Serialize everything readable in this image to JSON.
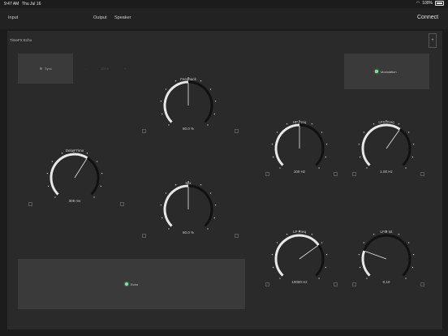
{
  "status": {
    "time": "9:47 AM",
    "date": "Thu Jul 16",
    "battery": "100%"
  },
  "nav": {
    "input": "Input",
    "output": "Output",
    "speaker": "Speaker",
    "connect": "Connect"
  },
  "panel": {
    "title": "TimeFX Echo",
    "add_label": "+"
  },
  "sync": {
    "label": "Sync",
    "minus": "-",
    "value": "120.0",
    "plus": "+"
  },
  "modulation": {
    "label": "Modulation"
  },
  "echo": {
    "label": "Echo"
  },
  "knobs": [
    {
      "name": "feedback",
      "label": "Feedback",
      "value": "50.0 %",
      "level": 0.5
    },
    {
      "name": "delay-time",
      "label": "Delay Time",
      "value": "309 ms",
      "level": 0.62
    },
    {
      "name": "mix",
      "label": "Mix",
      "value": "50.0 %",
      "level": 0.5
    },
    {
      "name": "hp-freq",
      "label": "HP Freq",
      "value": "100 Hz",
      "level": 0.5
    },
    {
      "name": "lfo-freq",
      "label": "LFO Freq",
      "value": "1.00 Hz",
      "level": 0.63
    },
    {
      "name": "lp-freq",
      "label": "LP Freq",
      "value": "10000 Hz",
      "level": 0.7
    },
    {
      "name": "lfo-int",
      "label": "LFO Int",
      "value": "0.10",
      "level": 0.24
    }
  ],
  "colors": {
    "accent": "#7fe0a8",
    "knob": "#e8e8e8",
    "track": "#111111"
  }
}
